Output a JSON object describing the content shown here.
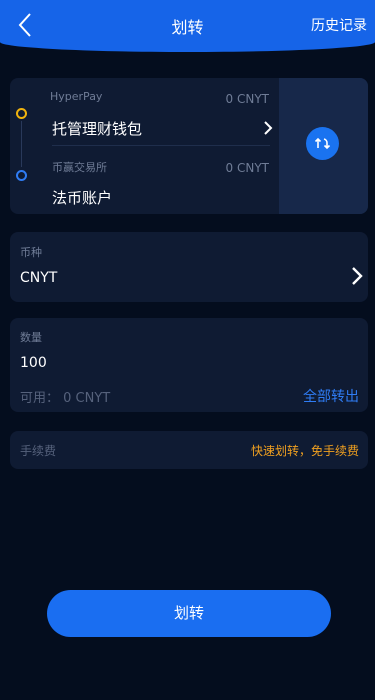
{
  "header": {
    "title": "划转",
    "history_label": "历史记录"
  },
  "transfer": {
    "from": {
      "name": "HyperPay",
      "balance": "0 CNYT",
      "account": "托管理财钱包"
    },
    "to": {
      "name": "币赢交易所",
      "balance": "0 CNYT",
      "account": "法币账户"
    }
  },
  "coin": {
    "label": "币种",
    "value": "CNYT"
  },
  "amount": {
    "label": "数量",
    "value": "100",
    "available": "可用：  0 CNYT",
    "all_label": "全部转出"
  },
  "fee": {
    "label": "手续费",
    "note": "快速划转，免手续费"
  },
  "submit_label": "划转",
  "colors": {
    "accent": "#1a6ef1",
    "header": "#1664e8",
    "background": "#040d1e",
    "card": "#0f1b33",
    "fee_note": "#f0a020",
    "from_dot": "#f0b30e",
    "to_dot": "#2f7cf4"
  },
  "icons": {
    "back": "chevron-left-icon",
    "swap": "swap-icon",
    "chevron": "chevron-right-icon"
  }
}
